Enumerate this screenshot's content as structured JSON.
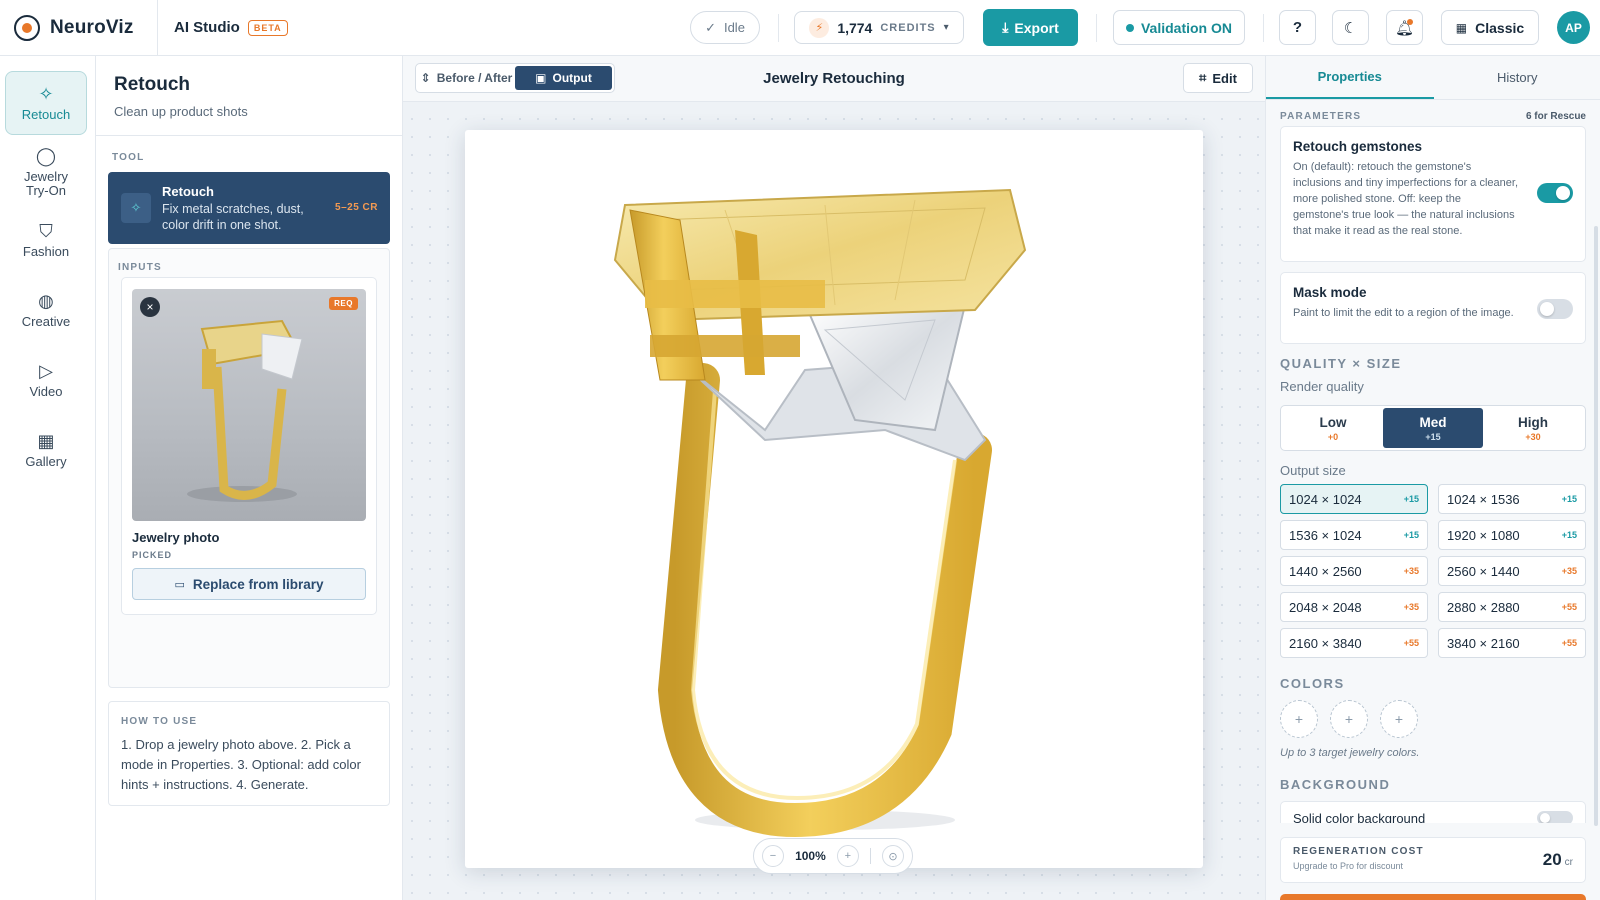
{
  "app": {
    "brand": "NeuroViz",
    "studio_title": "AI Studio",
    "badge": "BETA"
  },
  "topbar": {
    "status": "Idle",
    "credits": {
      "value": "1,774",
      "label": "CREDITS"
    },
    "export_label": "Export",
    "validation_label": "Validation ON",
    "layout_label": "Classic",
    "avatar_initials": "AP",
    "accent_color": "#1a9aa4",
    "brand_orange": "#e8782a"
  },
  "rail": {
    "items": [
      {
        "label": "Retouch",
        "icon": "sparkle-icon",
        "active": true
      },
      {
        "label": "Jewelry Try-On",
        "icon": "user-icon"
      },
      {
        "label": "Fashion",
        "icon": "shirt-icon"
      },
      {
        "label": "Creative",
        "icon": "palette-icon"
      },
      {
        "label": "Video",
        "icon": "video-icon"
      },
      {
        "label": "Gallery",
        "icon": "grid-icon"
      }
    ]
  },
  "toolpanel": {
    "title": "Retouch",
    "subtitle": "Clean up product shots",
    "tool_section": "TOOL",
    "tool": {
      "name": "Retouch",
      "desc": "Fix metal scratches, dust, color drift in one shot.",
      "cost": "5–25 CR"
    },
    "inputs_section": "INPUTS",
    "input": {
      "name": "Jewelry photo",
      "status": "PICKED",
      "tag": "REQ",
      "replace_label": "Replace from library"
    },
    "howto": {
      "label": "HOW TO USE",
      "text": "1. Drop a jewelry photo above. 2. Pick a mode in Properties. 3. Optional: add color hints + instructions. 4. Generate."
    }
  },
  "canvas": {
    "tabs": [
      {
        "label": "Before / After"
      },
      {
        "label": "Output",
        "active": true
      }
    ],
    "title": "Jewelry Retouching",
    "edit_label": "Edit",
    "zoom": "100%"
  },
  "properties": {
    "tabs": [
      {
        "label": "Properties",
        "active": true
      },
      {
        "label": "History"
      }
    ],
    "params_label": "PARAMETERS",
    "params_note": "6 for Rescue",
    "gemstones": {
      "title": "Retouch gemstones",
      "desc": "On (default): retouch the gemstone's inclusions and tiny imperfections for a cleaner, more polished stone. Off: keep the gemstone's true look — the natural inclusions that make it read as the real stone.",
      "on": true
    },
    "mask": {
      "title": "Mask mode",
      "desc": "Paint to limit the edit to a region of the image.",
      "on": false
    },
    "quality_size_label": "QUALITY × SIZE",
    "render_quality_label": "Render quality",
    "quality": [
      {
        "name": "Low",
        "cost": "+0"
      },
      {
        "name": "Med",
        "cost": "+15",
        "active": true
      },
      {
        "name": "High",
        "cost": "+30"
      }
    ],
    "output_size_label": "Output size",
    "sizes": [
      {
        "value": "1024 × 1024",
        "cost": "+15",
        "active": true,
        "color": "#1a9aa4"
      },
      {
        "value": "1024 × 1536",
        "cost": "+15",
        "color": "#1a9aa4"
      },
      {
        "value": "1536 × 1024",
        "cost": "+15",
        "color": "#1a9aa4"
      },
      {
        "value": "1920 × 1080",
        "cost": "+15",
        "color": "#1a9aa4"
      },
      {
        "value": "1440 × 2560",
        "cost": "+35",
        "color": "#e8782a"
      },
      {
        "value": "2560 × 1440",
        "cost": "+35",
        "color": "#e8782a"
      },
      {
        "value": "2048 × 2048",
        "cost": "+35",
        "color": "#e8782a"
      },
      {
        "value": "2880 × 2880",
        "cost": "+55",
        "color": "#e8782a"
      },
      {
        "value": "2160 × 3840",
        "cost": "+55",
        "color": "#e8782a"
      },
      {
        "value": "3840 × 2160",
        "cost": "+55",
        "color": "#e8782a"
      }
    ],
    "colors_label": "COLORS",
    "colors_hint": "Up to 3 target jewelry colors.",
    "background_label": "BACKGROUND",
    "background_option": "Solid color background",
    "cost": {
      "label": "REGENERATION COST",
      "sub": "Upgrade to Pro for discount",
      "value": "20",
      "unit": "cr"
    }
  }
}
